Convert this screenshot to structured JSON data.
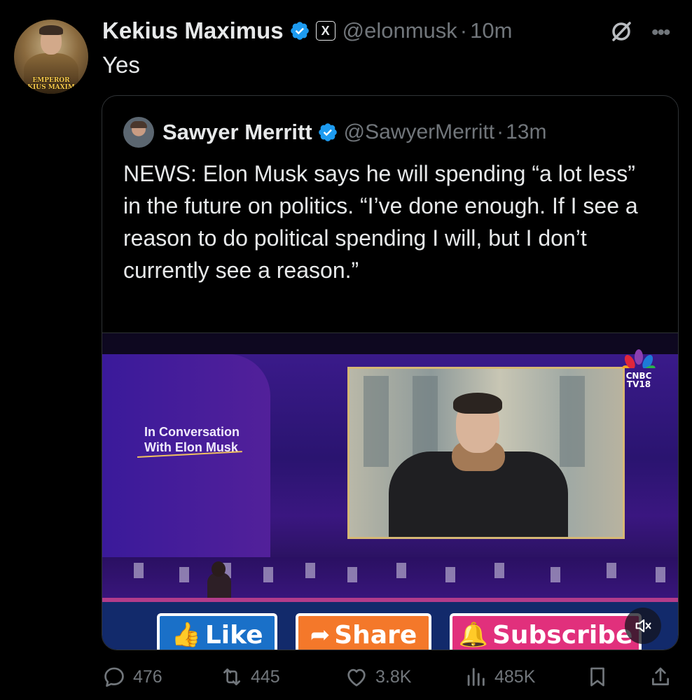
{
  "tweet": {
    "author_name": "Kekius Maximus",
    "author_handle": "@elonmusk",
    "separator": "·",
    "time": "10m",
    "text": "Yes",
    "avatar_caption_line1": "EMPEROR",
    "avatar_caption_line2": "KIUS MAXIM",
    "affiliate_badge": "X"
  },
  "quote": {
    "author_name": "Sawyer Merritt",
    "author_handle": "@SawyerMerritt",
    "separator": "·",
    "time": "13m",
    "text": "NEWS: Elon Musk says he will spending “a lot less” in the future on politics. “I’ve done enough. If I see a reason to do political spending I will, but I don’t currently see a reason.”"
  },
  "video": {
    "stage_title_line1": "In Conversation",
    "stage_title_line2": "With Elon Musk",
    "logo_line1": "CNBC",
    "logo_line2": "TV18",
    "like_label": "Like",
    "share_label": "Share",
    "subscribe_label": "Subscribe",
    "muted": true
  },
  "actions": {
    "replies": "476",
    "reposts": "445",
    "likes": "3.8K",
    "views": "485K"
  },
  "colors": {
    "background": "#000000",
    "text": "#e7e9ea",
    "muted_text": "#71767b",
    "verified": "#1d9bf0",
    "border": "#2f3336"
  }
}
